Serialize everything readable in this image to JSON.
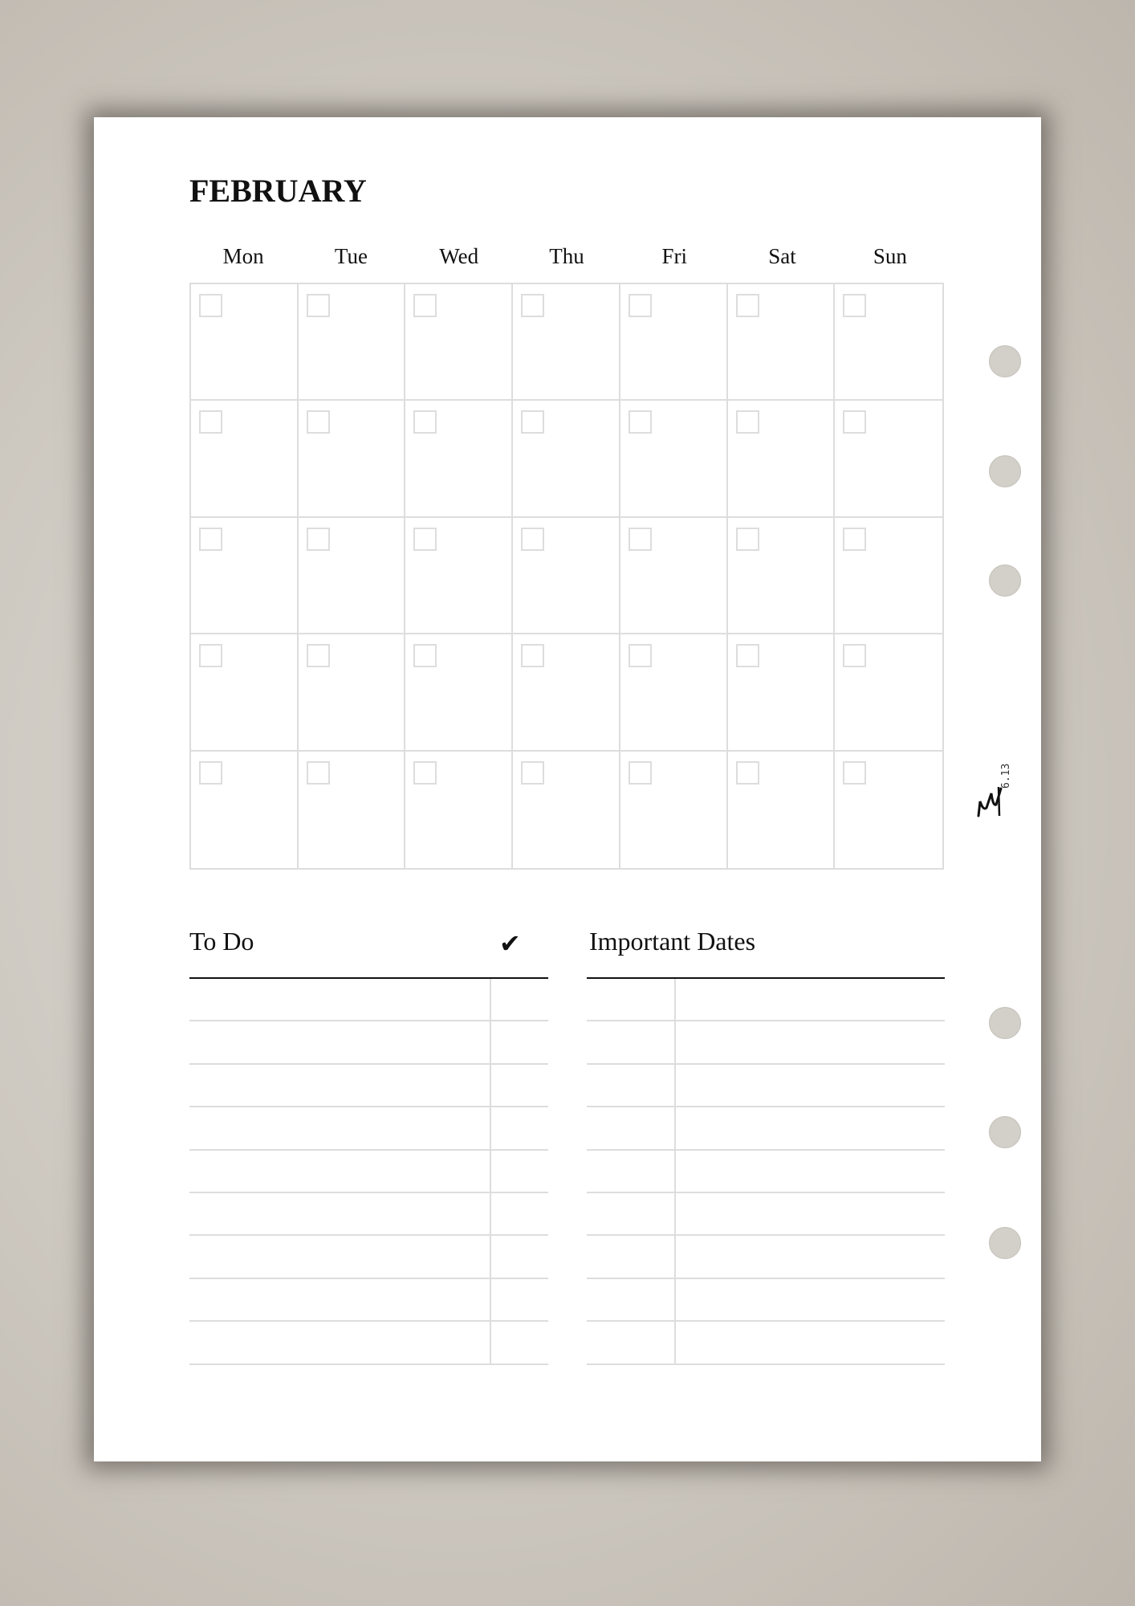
{
  "title": "FEBRUARY",
  "weekdays": [
    "Mon",
    "Tue",
    "Wed",
    "Thu",
    "Fri",
    "Sat",
    "Sun"
  ],
  "calendar": {
    "rows": 5,
    "columns": 7
  },
  "todo": {
    "title": "To Do",
    "check_icon": "checkmark-icon",
    "rows": 9
  },
  "important_dates": {
    "title": "Important Dates",
    "rows": 9
  },
  "logo": {
    "text": "M",
    "version": "6.13"
  },
  "colors": {
    "background": "#cdc8c0",
    "page": "#ffffff",
    "grid": "#dddddd",
    "hole": "#d3d0ca"
  }
}
